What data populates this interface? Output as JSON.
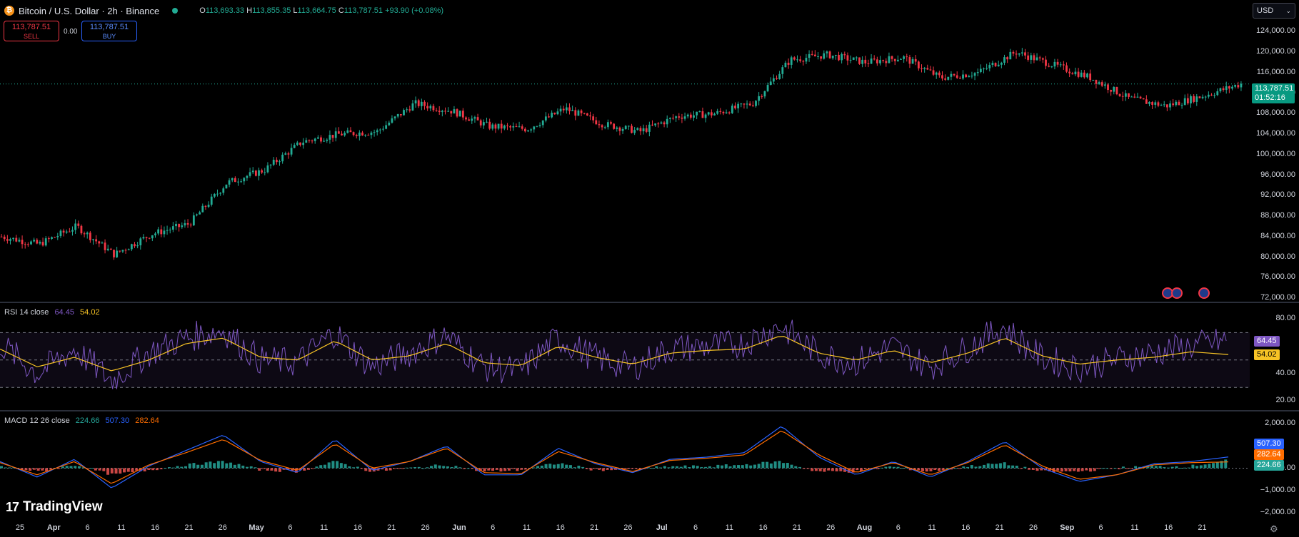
{
  "header": {
    "symbol": "Bitcoin / U.S. Dollar · 2h · Binance",
    "coin_icon": "bitcoin-icon",
    "ohlc": {
      "o_label": "O",
      "o": "113,693.33",
      "h_label": "H",
      "h": "113,855.35",
      "l_label": "L",
      "l": "113,664.75",
      "c_label": "C",
      "c": "113,787.51",
      "change": "+93.90 (+0.08%)"
    },
    "sell_price": "113,787.51",
    "sell_label": "SELL",
    "buy_price": "113,787.51",
    "buy_label": "BUY",
    "spread": "0.00",
    "currency": "USD"
  },
  "price_axis": {
    "ticks": [
      "124,000.00",
      "120,000.00",
      "116,000.00",
      "112,000.00",
      "108,000.00",
      "104,000.00",
      "100,000.00",
      "96,000.00",
      "92,000.00",
      "88,000.00",
      "84,000.00",
      "80,000.00",
      "76,000.00",
      "72,000.00"
    ],
    "last_price": "113,787.51",
    "countdown": "01:52:16"
  },
  "rsi": {
    "title": "RSI 14 close",
    "value": "64.45",
    "ma": "54.02",
    "ticks": [
      "80.00",
      "40.00",
      "20.00"
    ],
    "band_upper": 70,
    "band_mid": 50,
    "band_lower": 30
  },
  "macd": {
    "title": "MACD 12 26 close",
    "hist": "224.66",
    "macd": "507.30",
    "signal": "282.64",
    "ticks": [
      "2,000.00",
      "0.00",
      "−1,000.00",
      "−2,000.00"
    ]
  },
  "time_axis": {
    "labels": [
      {
        "t": "25",
        "bold": false
      },
      {
        "t": "Apr",
        "bold": true
      },
      {
        "t": "6",
        "bold": false
      },
      {
        "t": "11",
        "bold": false
      },
      {
        "t": "16",
        "bold": false
      },
      {
        "t": "21",
        "bold": false
      },
      {
        "t": "26",
        "bold": false
      },
      {
        "t": "May",
        "bold": true
      },
      {
        "t": "6",
        "bold": false
      },
      {
        "t": "11",
        "bold": false
      },
      {
        "t": "16",
        "bold": false
      },
      {
        "t": "21",
        "bold": false
      },
      {
        "t": "26",
        "bold": false
      },
      {
        "t": "Jun",
        "bold": true
      },
      {
        "t": "6",
        "bold": false
      },
      {
        "t": "11",
        "bold": false
      },
      {
        "t": "16",
        "bold": false
      },
      {
        "t": "21",
        "bold": false
      },
      {
        "t": "26",
        "bold": false
      },
      {
        "t": "Jul",
        "bold": true
      },
      {
        "t": "6",
        "bold": false
      },
      {
        "t": "11",
        "bold": false
      },
      {
        "t": "16",
        "bold": false
      },
      {
        "t": "21",
        "bold": false
      },
      {
        "t": "26",
        "bold": false
      },
      {
        "t": "Aug",
        "bold": true
      },
      {
        "t": "6",
        "bold": false
      },
      {
        "t": "11",
        "bold": false
      },
      {
        "t": "16",
        "bold": false
      },
      {
        "t": "21",
        "bold": false
      },
      {
        "t": "26",
        "bold": false
      },
      {
        "t": "Sep",
        "bold": true
      },
      {
        "t": "6",
        "bold": false
      },
      {
        "t": "11",
        "bold": false
      },
      {
        "t": "16",
        "bold": false
      },
      {
        "t": "21",
        "bold": false
      }
    ]
  },
  "branding": {
    "name": "TradingView",
    "mark": "17"
  },
  "colors": {
    "up": "#22ab94",
    "down": "#f23645",
    "rsi": "#7e57c2",
    "rsi_ma": "#f7c325",
    "macd": "#2962ff",
    "signal": "#ff6d00",
    "hist_up": "#26a69a",
    "hist_down": "#ef5350"
  },
  "chart_data": [
    {
      "type": "line",
      "title": "Bitcoin / U.S. Dollar · 2h · Binance",
      "x": [
        "25",
        "Apr",
        "6",
        "11",
        "16",
        "21",
        "26",
        "May",
        "6",
        "11",
        "16",
        "21",
        "26",
        "Jun",
        "6",
        "11",
        "16",
        "21",
        "26",
        "Jul",
        "6",
        "11",
        "16",
        "21",
        "26",
        "Aug",
        "6",
        "11",
        "16",
        "21",
        "26",
        "Sep",
        "6",
        "11"
      ],
      "series": [
        {
          "name": "",
          "values": [
            84000,
            82500,
            86000,
            80500,
            84500,
            86500,
            94500,
            97000,
            102500,
            104000,
            104500,
            110000,
            108500,
            105500,
            105000,
            109000,
            106000,
            104500,
            107500,
            108000,
            110000,
            118500,
            119500,
            118000,
            119000,
            115000,
            116000,
            120000,
            117500,
            115000,
            111000,
            109500,
            111500,
            113800
          ]
        }
      ],
      "ylim": [
        72000,
        126000
      ]
    },
    {
      "type": "line",
      "title": "RSI 14 close",
      "series": [
        {
          "name": "",
          "values": [
            62,
            40,
            58,
            35,
            55,
            66,
            72,
            50,
            48,
            70,
            45,
            55,
            68,
            45,
            42,
            66,
            52,
            44,
            58,
            60,
            62,
            75,
            55,
            48,
            60,
            45,
            58,
            74,
            52,
            44,
            50,
            55,
            60,
            64
          ]
        },
        {
          "name": "",
          "values": [
            58,
            45,
            52,
            42,
            50,
            62,
            66,
            52,
            50,
            64,
            50,
            53,
            62,
            48,
            46,
            60,
            52,
            47,
            55,
            57,
            58,
            68,
            55,
            50,
            57,
            48,
            55,
            66,
            53,
            47,
            50,
            52,
            56,
            54
          ]
        }
      ],
      "ylim": [
        15,
        90
      ]
    },
    {
      "type": "line",
      "title": "MACD 12 26 close",
      "series": [
        {
          "name": "",
          "values": [
            300,
            -400,
            400,
            -900,
            100,
            800,
            1500,
            300,
            -200,
            1300,
            -100,
            300,
            1000,
            -300,
            -300,
            900,
            200,
            -200,
            400,
            500,
            700,
            1900,
            500,
            -300,
            300,
            -400,
            300,
            1200,
            0,
            -600,
            -300,
            200,
            300,
            507
          ]
        },
        {
          "name": "",
          "values": [
            250,
            -300,
            300,
            -700,
            150,
            700,
            1300,
            350,
            -100,
            1100,
            0,
            300,
            900,
            -200,
            -250,
            750,
            250,
            -150,
            350,
            450,
            600,
            1700,
            600,
            -200,
            250,
            -300,
            250,
            1050,
            100,
            -500,
            -300,
            150,
            250,
            283
          ]
        }
      ],
      "ylim": [
        -2300,
        2300
      ]
    }
  ]
}
